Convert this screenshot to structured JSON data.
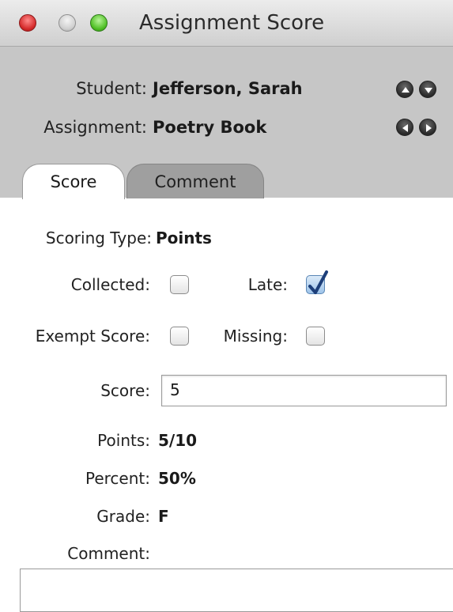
{
  "window": {
    "title": "Assignment Score"
  },
  "header": {
    "student_label": "Student:",
    "student_value": "Jefferson, Sarah",
    "assignment_label": "Assignment:",
    "assignment_value": "Poetry Book"
  },
  "tabs": [
    {
      "label": "Score",
      "active": true
    },
    {
      "label": "Comment",
      "active": false
    }
  ],
  "score_tab": {
    "scoring_type_label": "Scoring Type:",
    "scoring_type_value": "Points",
    "collected_label": "Collected:",
    "collected_checked": false,
    "late_label": "Late:",
    "late_checked": true,
    "exempt_label": "Exempt Score:",
    "exempt_checked": false,
    "missing_label": "Missing:",
    "missing_checked": false,
    "score_label": "Score:",
    "score_value": "5",
    "points_label": "Points:",
    "points_value": "5/10",
    "percent_label": "Percent:",
    "percent_value": "50%",
    "grade_label": "Grade:",
    "grade_value": "F",
    "comment_label": "Comment:",
    "comment_value": ""
  },
  "icons": {
    "student_prev": "triangle-up-icon",
    "student_next": "triangle-down-icon",
    "assignment_prev": "triangle-left-icon",
    "assignment_next": "triangle-right-icon",
    "checkmark": "checkmark-icon"
  },
  "colors": {
    "header_bg": "#c6c6c6",
    "inactive_tab_bg": "#9f9f9f",
    "checkbox_checked_bg": "#9ec4ea",
    "checkmark": "#1d3f7a",
    "close_button": "#d42a2a",
    "zoom_button": "#4fbf24"
  }
}
